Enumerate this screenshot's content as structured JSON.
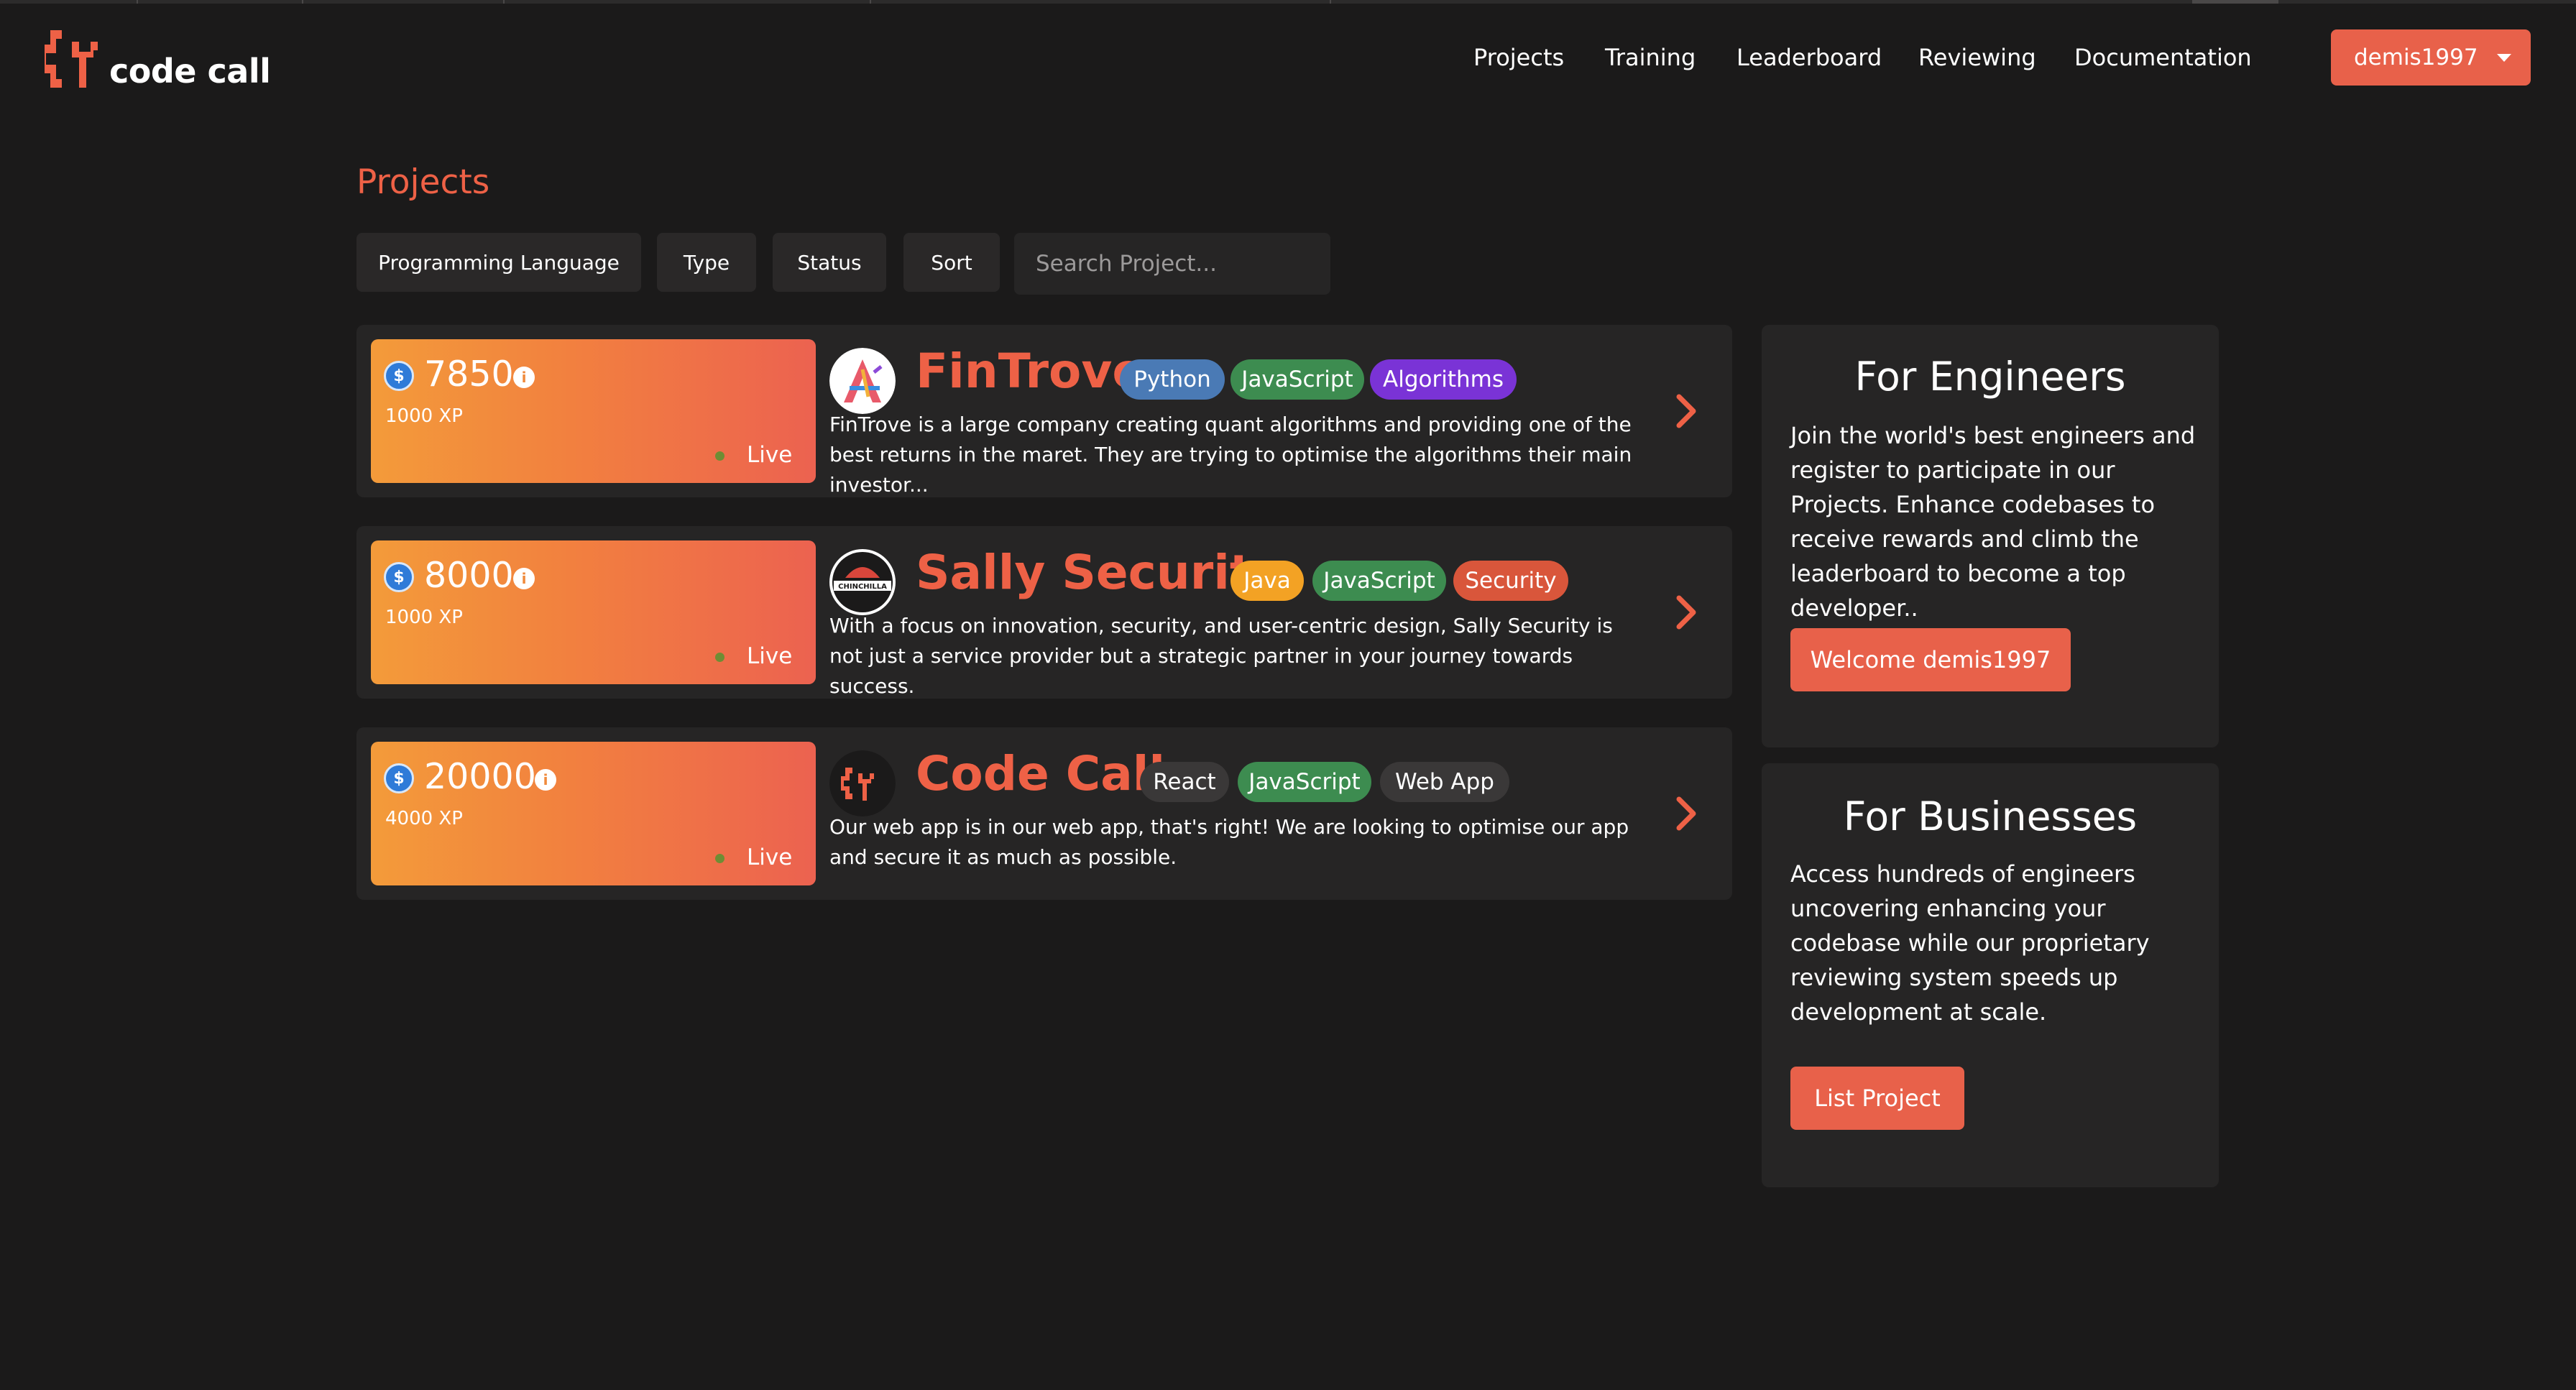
{
  "brand": {
    "name": "code call",
    "accent": "#ee6146"
  },
  "nav": {
    "items": [
      "Projects",
      "Training",
      "Leaderboard",
      "Reviewing",
      "Documentation"
    ],
    "user": "demis1997"
  },
  "page": {
    "title": "Projects",
    "filters": [
      "Programming Language",
      "Type",
      "Status",
      "Sort"
    ],
    "search_placeholder": "Search Project..."
  },
  "projects": [
    {
      "reward": "7850",
      "xp": "1000 XP",
      "status": "Live",
      "name": "FinTrove",
      "tags": [
        {
          "label": "Python",
          "color": "#4a7ab5"
        },
        {
          "label": "JavaScript",
          "color": "#3d8c50"
        },
        {
          "label": "Algorithms",
          "color": "#7a33d6"
        }
      ],
      "description": "FinTrove is a large company creating quant algorithms and providing one of the best returns in the maret. They are trying to optimise the algorithms their main investor..."
    },
    {
      "reward": "8000",
      "xp": "1000 XP",
      "status": "Live",
      "name": "Sally Security",
      "logo_text": "CHINCHILLA",
      "tags": [
        {
          "label": "Java",
          "color": "#f3a224"
        },
        {
          "label": "JavaScript",
          "color": "#3d8c50"
        },
        {
          "label": "Security",
          "color": "#d9563b"
        }
      ],
      "description": "With a focus on innovation, security, and user-centric design, Sally Security is not just a service provider but a strategic partner in your journey towards success."
    },
    {
      "reward": "20000",
      "xp": "4000 XP",
      "status": "Live",
      "name": "Code Call",
      "tags": [
        {
          "label": "React",
          "color": "#3a3838"
        },
        {
          "label": "JavaScript",
          "color": "#3d8c50"
        },
        {
          "label": "Web App",
          "color": "#3a3838"
        }
      ],
      "description": "Our web app is in our web app, that's right! We are looking to optimise our app and secure it as much as possible."
    }
  ],
  "engineers": {
    "title": "For Engineers",
    "text": "Join the world's best engineers and register to participate in our Projects. Enhance codebases to receive rewards and climb the leaderboard to become a top developer..",
    "button": "Welcome demis1997"
  },
  "businesses": {
    "title": "For Businesses",
    "text": "Access hundreds of engineers uncovering enhancing your codebase while our proprietary reviewing system speeds up development at scale.",
    "button": "List Project"
  },
  "icons": {
    "coin": "dollar-coin-icon",
    "info": "info-icon",
    "chevron": "chevron-right-icon",
    "caret": "caret-down-icon"
  }
}
